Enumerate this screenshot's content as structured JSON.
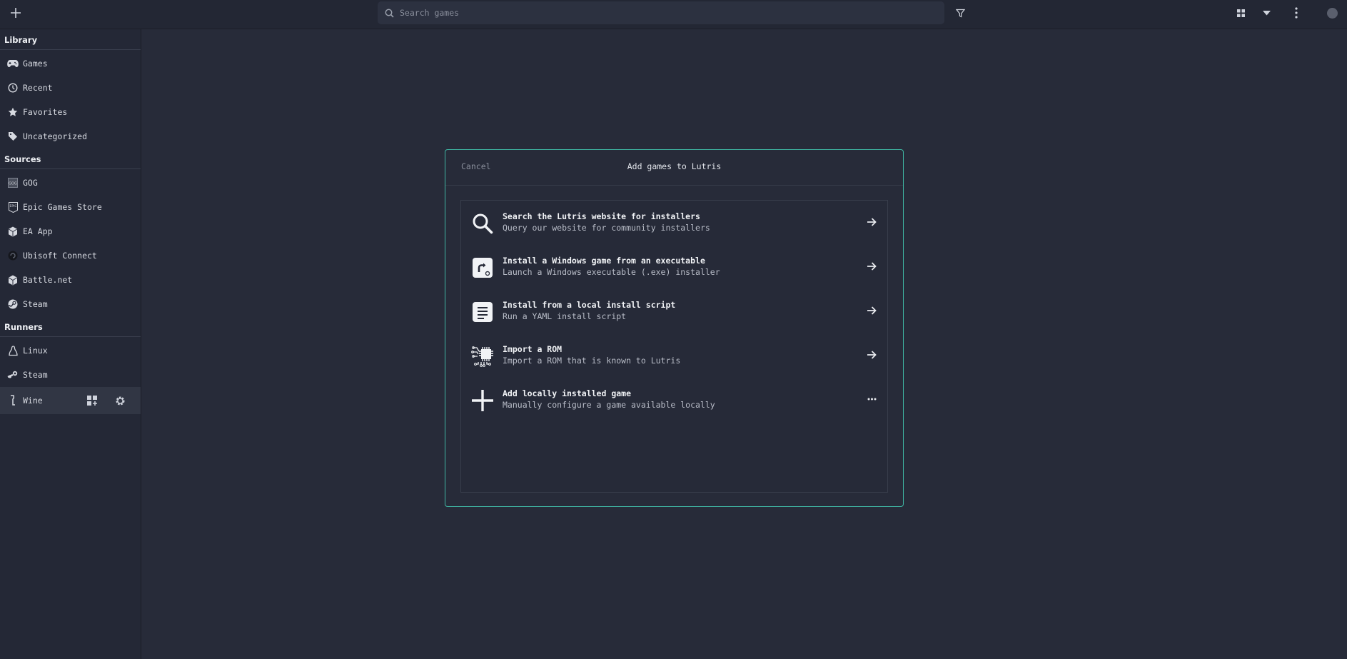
{
  "header": {
    "search_placeholder": "Search games"
  },
  "sidebar": {
    "sections": {
      "library": "Library",
      "sources": "Sources",
      "runners": "Runners"
    },
    "library_items": [
      {
        "label": "Games",
        "icon": "gamepad-icon"
      },
      {
        "label": "Recent",
        "icon": "clock-icon"
      },
      {
        "label": "Favorites",
        "icon": "star-icon"
      },
      {
        "label": "Uncategorized",
        "icon": "tag-icon"
      }
    ],
    "source_items": [
      {
        "label": "GOG",
        "icon": "gog-icon"
      },
      {
        "label": "Epic Games Store",
        "icon": "epic-icon"
      },
      {
        "label": "EA App",
        "icon": "ea-icon"
      },
      {
        "label": "Ubisoft Connect",
        "icon": "ubisoft-icon"
      },
      {
        "label": "Battle.net",
        "icon": "battlenet-icon"
      },
      {
        "label": "Steam",
        "icon": "steam-icon"
      }
    ],
    "runner_items": [
      {
        "label": "Linux",
        "icon": "linux-icon"
      },
      {
        "label": "Steam",
        "icon": "steam-runner-icon"
      },
      {
        "label": "Wine",
        "icon": "wine-icon"
      }
    ]
  },
  "dialog": {
    "cancel": "Cancel",
    "title": "Add games to Lutris",
    "options": [
      {
        "title": "Search the Lutris website for installers",
        "subtitle": "Query our website for community installers",
        "icon": "search-icon",
        "action": "arrow-right-icon"
      },
      {
        "title": "Install a Windows game from an executable",
        "subtitle": "Launch a Windows executable (.exe) installer",
        "icon": "executable-icon",
        "action": "arrow-right-icon"
      },
      {
        "title": "Install from a local install script",
        "subtitle": "Run a YAML install script",
        "icon": "script-icon",
        "action": "arrow-right-icon"
      },
      {
        "title": "Import a ROM",
        "subtitle": "Import a ROM that is known to Lutris",
        "icon": "rom-chip-icon",
        "action": "arrow-right-icon"
      },
      {
        "title": "Add locally installed game",
        "subtitle": "Manually configure a game available locally",
        "icon": "plus-icon",
        "action": "more-icon"
      }
    ]
  },
  "colors": {
    "background": "#272b39",
    "accent_border": "#3fb6a3",
    "text": "#d6d9e0"
  }
}
